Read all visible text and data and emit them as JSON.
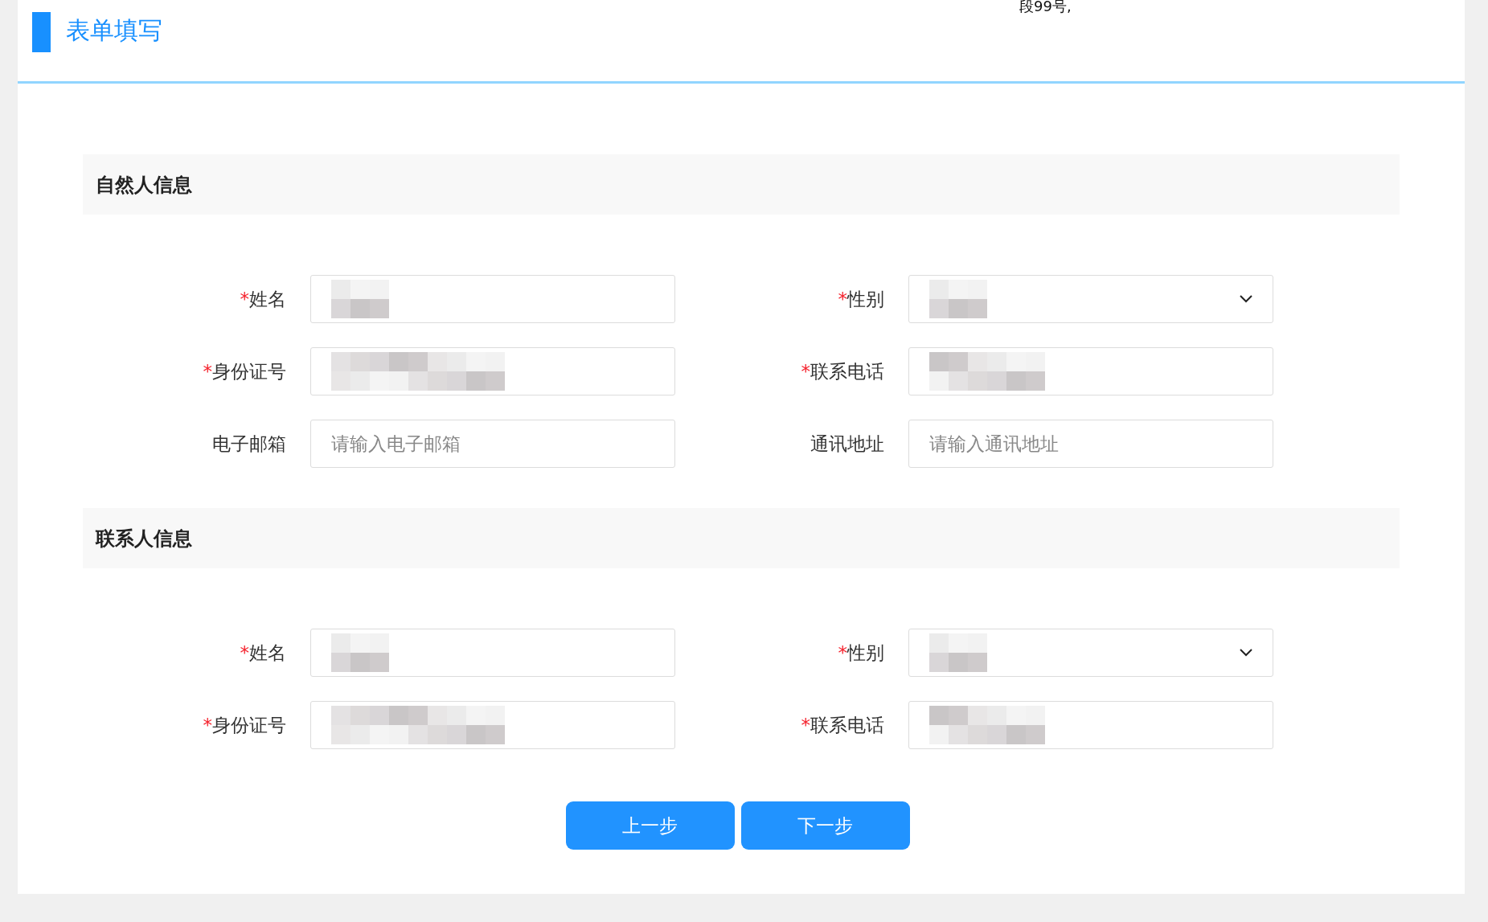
{
  "header": {
    "title": "表单填写",
    "cut_text": "段99号,"
  },
  "sections": [
    {
      "title": "自然人信息",
      "fields": [
        {
          "label": "姓名",
          "required_mark": "*",
          "kind": "text",
          "redacted": true
        },
        {
          "label": "性别",
          "required_mark": "*",
          "kind": "select",
          "redacted": true
        },
        {
          "label": "身份证号",
          "required_mark": "*",
          "kind": "text",
          "redacted": true
        },
        {
          "label": "联系电话",
          "required_mark": "*",
          "kind": "text",
          "redacted": true
        },
        {
          "label": "电子邮箱",
          "kind": "text",
          "placeholder": "请输入电子邮箱"
        },
        {
          "label": "通讯地址",
          "kind": "text",
          "placeholder": "请输入通讯地址"
        }
      ]
    },
    {
      "title": "联系人信息",
      "fields": [
        {
          "label": "姓名",
          "required_mark": "*",
          "kind": "text",
          "redacted": true
        },
        {
          "label": "性别",
          "required_mark": "*",
          "kind": "select",
          "redacted": true
        },
        {
          "label": "身份证号",
          "required_mark": "*",
          "kind": "text",
          "redacted": true
        },
        {
          "label": "联系电话",
          "required_mark": "*",
          "kind": "text",
          "redacted": true
        }
      ]
    }
  ],
  "buttons": [
    "上一步",
    "下一步"
  ]
}
